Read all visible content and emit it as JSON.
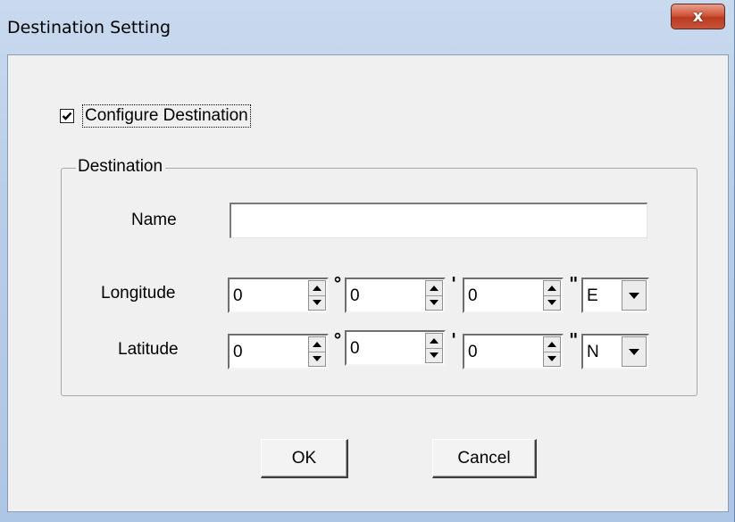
{
  "window": {
    "title": "Destination Setting",
    "close_label": "x"
  },
  "configure": {
    "label": "Configure Destination",
    "checked": true
  },
  "group": {
    "title": "Destination",
    "name_label": "Name",
    "name_value": "",
    "longitude": {
      "label": "Longitude",
      "deg": "0",
      "min": "0",
      "sec": "0",
      "dir": "E"
    },
    "latitude": {
      "label": "Latitude",
      "deg": "0",
      "min": "0",
      "sec": "0",
      "dir": "N"
    },
    "symbols": {
      "degree": "°",
      "minute": "'",
      "second": "\""
    }
  },
  "buttons": {
    "ok": "OK",
    "cancel": "Cancel"
  }
}
